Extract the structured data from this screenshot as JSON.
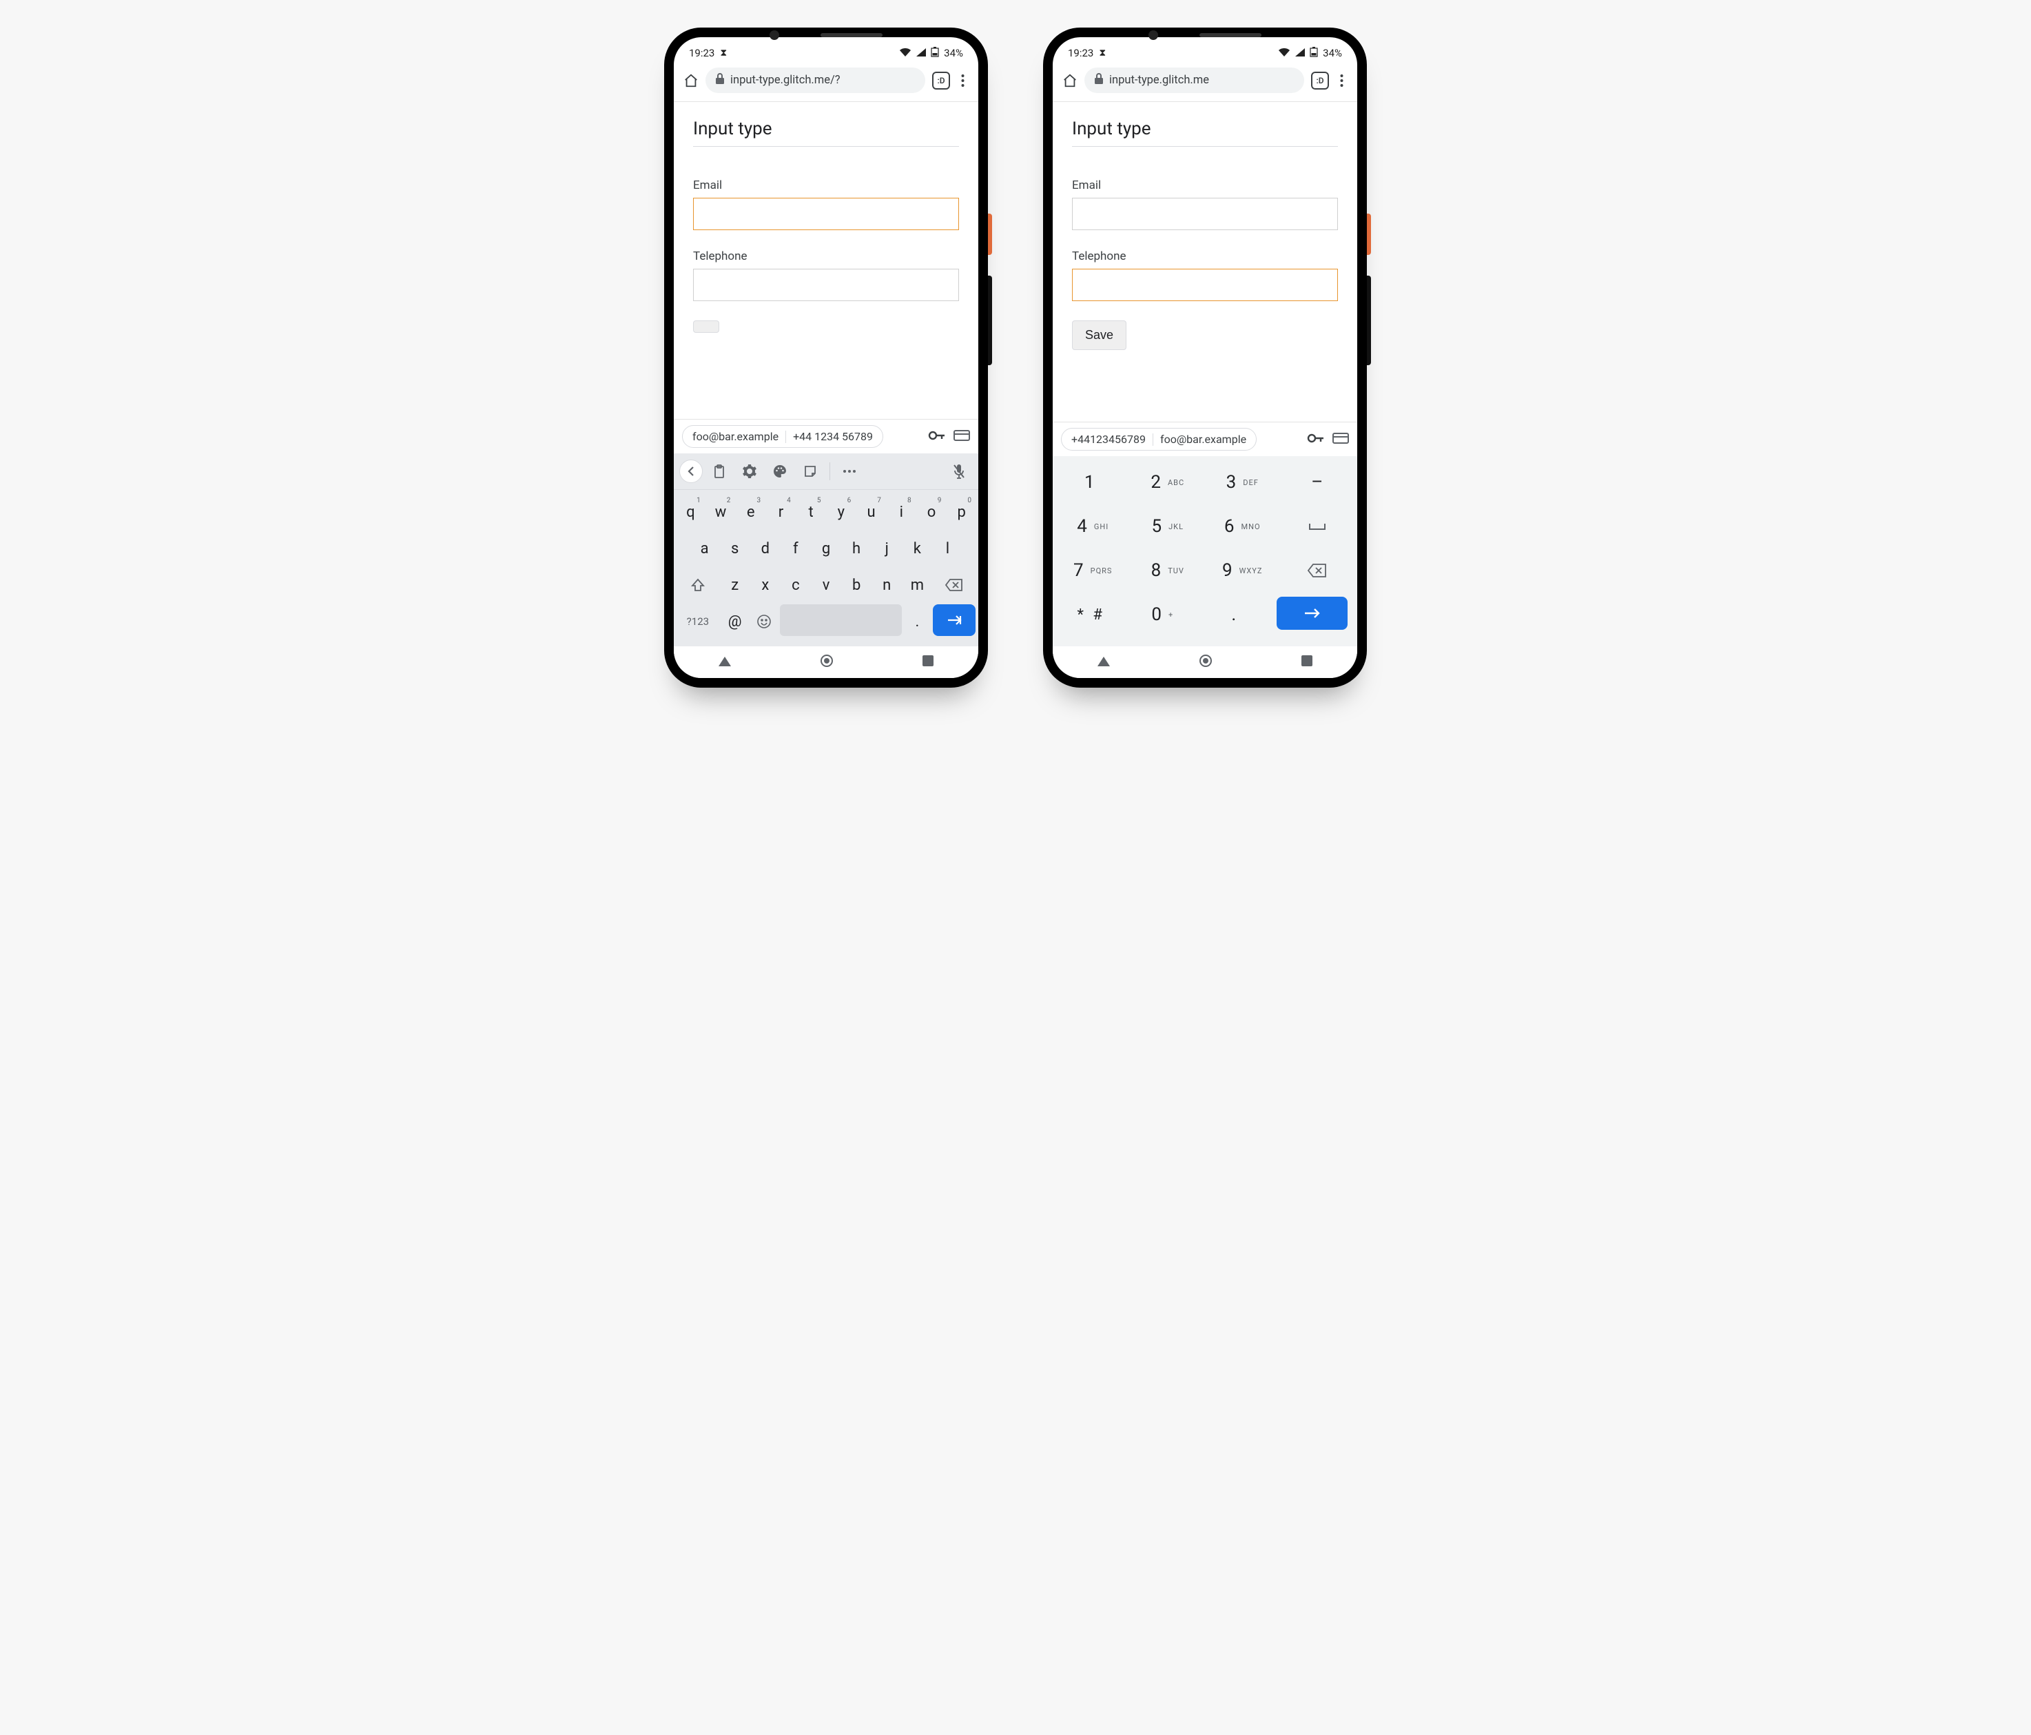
{
  "status": {
    "time": "19:23",
    "battery": "34%"
  },
  "browser": {
    "url_left": "input-type.glitch.me/?",
    "url_right": "input-type.glitch.me",
    "tab_count": ":D"
  },
  "page": {
    "heading": "Input type",
    "email_label": "Email",
    "tel_label": "Telephone",
    "save_label": "Save"
  },
  "autofill": {
    "email": "foo@bar.example",
    "phone_spaced": "+44 1234 56789",
    "phone_tight": "+44123456789"
  },
  "qwerty": {
    "row1": [
      {
        "k": "q",
        "n": "1"
      },
      {
        "k": "w",
        "n": "2"
      },
      {
        "k": "e",
        "n": "3"
      },
      {
        "k": "r",
        "n": "4"
      },
      {
        "k": "t",
        "n": "5"
      },
      {
        "k": "y",
        "n": "6"
      },
      {
        "k": "u",
        "n": "7"
      },
      {
        "k": "i",
        "n": "8"
      },
      {
        "k": "o",
        "n": "9"
      },
      {
        "k": "p",
        "n": "0"
      }
    ],
    "row2": [
      "a",
      "s",
      "d",
      "f",
      "g",
      "h",
      "j",
      "k",
      "l"
    ],
    "row3": [
      "z",
      "x",
      "c",
      "v",
      "b",
      "n",
      "m"
    ],
    "sym_label": "?123",
    "at_key": "@",
    "period_key": "."
  },
  "dialpad": {
    "rows": [
      [
        {
          "n": "1",
          "l": ""
        },
        {
          "n": "2",
          "l": "ABC"
        },
        {
          "n": "3",
          "l": "DEF"
        }
      ],
      [
        {
          "n": "4",
          "l": "GHI"
        },
        {
          "n": "5",
          "l": "JKL"
        },
        {
          "n": "6",
          "l": "MNO"
        }
      ],
      [
        {
          "n": "7",
          "l": "PQRS"
        },
        {
          "n": "8",
          "l": "TUV"
        },
        {
          "n": "9",
          "l": "WXYZ"
        }
      ],
      [
        {
          "n": "* #",
          "l": ""
        },
        {
          "n": "0",
          "l": "+"
        },
        {
          "n": ".",
          "l": ""
        }
      ]
    ],
    "dash": "–",
    "space": "⎵"
  }
}
